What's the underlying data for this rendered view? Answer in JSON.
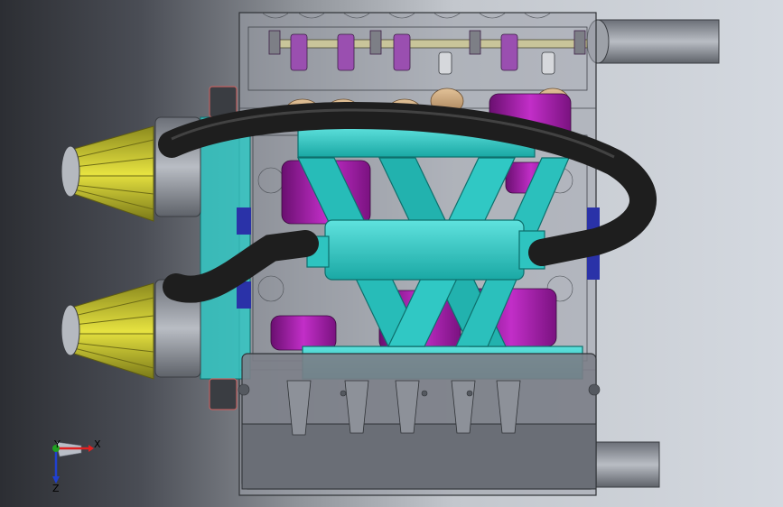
{
  "triad": {
    "x_label": "X",
    "y_label": "Y",
    "z_label": "Z"
  },
  "colors": {
    "background_dark": "#2c2e33",
    "background_light": "#d4d9e0",
    "frame_transparent": "#8c9098",
    "manifold_cyan": "#2ec4c0",
    "piston_magenta": "#a21aa8",
    "hose_black": "#1e1e1e",
    "filter_yellow": "#d8d42a",
    "tan_part": "#c8a27a",
    "axis_x_red": "#e02020",
    "axis_y_green": "#20a020",
    "axis_z_blue": "#2040d0"
  },
  "icons": {
    "air_filter": "cone-filter-icon",
    "triad": "axis-triad-icon"
  }
}
